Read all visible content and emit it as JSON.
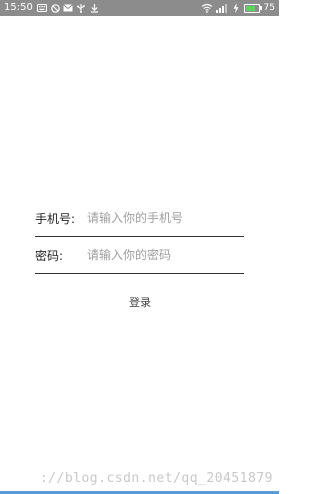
{
  "status_bar": {
    "time": "15:50",
    "battery_level": "75",
    "battery_fraction": 0.75,
    "icons_left": [
      "keyboard-icon",
      "blocked-icon",
      "mail-icon",
      "usb-icon",
      "download-icon"
    ],
    "icons_right": [
      "wifi-icon",
      "signal-icon",
      "charging-icon"
    ]
  },
  "form": {
    "phone": {
      "label": "手机号:",
      "placeholder": "请输入你的手机号",
      "value": ""
    },
    "password": {
      "label": "密码:",
      "placeholder": "请输入你的密码",
      "value": ""
    },
    "login_label": "登录"
  },
  "watermark": "://blog.csdn.net/qq_20451879"
}
